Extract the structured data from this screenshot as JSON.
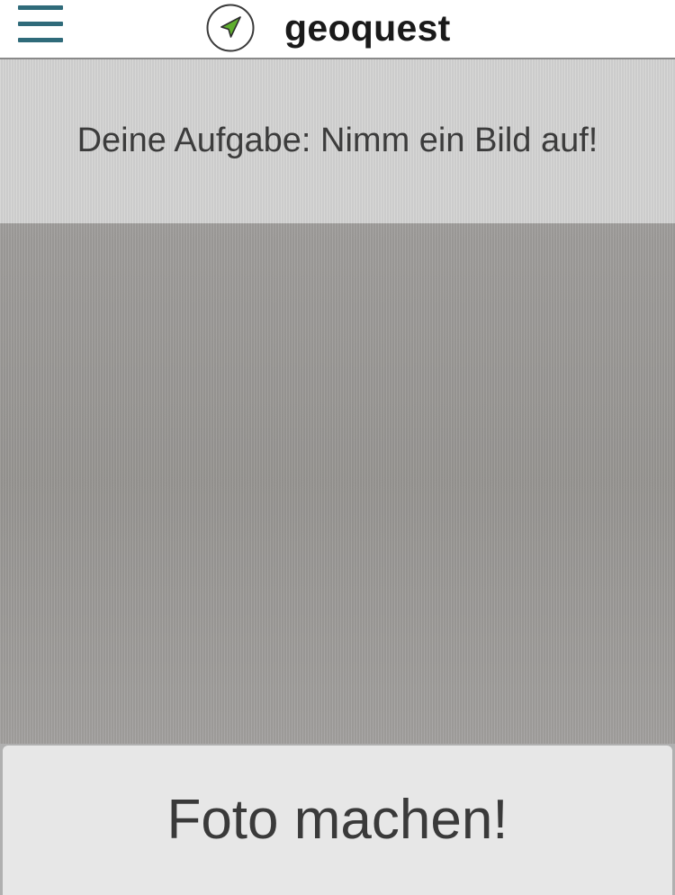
{
  "app": {
    "title": "geoquest",
    "logo_icon": "navigation-arrow-icon",
    "menu_icon": "hamburger-menu-icon"
  },
  "task": {
    "text": "Deine Aufgabe: Nimm ein Bild auf!"
  },
  "viewfinder": {
    "icon": "camera-preview"
  },
  "capture": {
    "label": "Foto machen!"
  },
  "colors": {
    "menu_accent": "#2f6b7a",
    "logo_arrow": "#5fae2e",
    "header_bg": "#ffffff",
    "banner_bg": "#d3d3d2",
    "viewfinder_bg": "#9a9896",
    "button_bg": "#e7e7e7"
  }
}
